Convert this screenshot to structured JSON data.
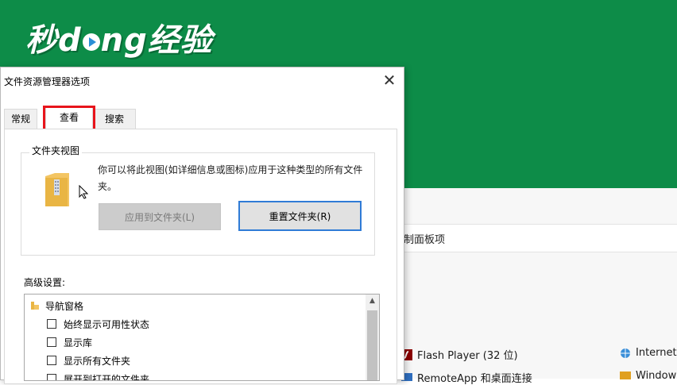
{
  "brand": {
    "logo_text_prefix": "秒d",
    "logo_text_suffix": "ng经验"
  },
  "background": {
    "breadcrumb": "制面板项",
    "items": [
      {
        "label": "Flash Player (32 位)"
      },
      {
        "label": "Internet"
      },
      {
        "label": "RemoteApp 和桌面连接"
      },
      {
        "label": "Window"
      }
    ]
  },
  "dialog": {
    "title": "文件资源管理器选项",
    "close_symbol": "✕",
    "tabs": [
      {
        "label": "常规"
      },
      {
        "label": "查看"
      },
      {
        "label": "搜索"
      }
    ],
    "active_tab": "查看",
    "folder_views": {
      "label": "文件夹视图",
      "description": "你可以将此视图(如详细信息或图标)应用于这种类型的所有文件夹。",
      "apply_button": "应用到文件夹(L)",
      "reset_button": "重置文件夹(R)"
    },
    "advanced": {
      "label": "高级设置:",
      "root": "导航窗格",
      "items": [
        {
          "label": "始终显示可用性状态",
          "checked": false
        },
        {
          "label": "显示库",
          "checked": false
        },
        {
          "label": "显示所有文件夹",
          "checked": false
        },
        {
          "label": "展开到打开的文件夹",
          "checked": false
        }
      ]
    }
  },
  "colors": {
    "banner": "#0d8c48",
    "highlight": "#e8141b",
    "focus": "#2f7bd6"
  }
}
